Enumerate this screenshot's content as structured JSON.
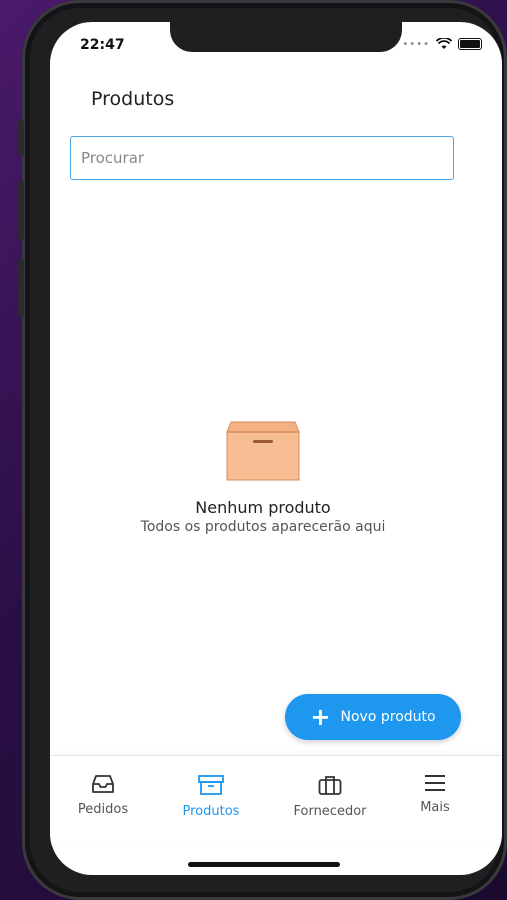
{
  "status": {
    "time": "22:47"
  },
  "header": {
    "title": "Produtos"
  },
  "search": {
    "placeholder": "Procurar"
  },
  "empty_state": {
    "title": "Nenhum produto",
    "subtitle": "Todos os produtos aparecerão aqui",
    "icon": "box-icon"
  },
  "fab": {
    "label": "Novo produto",
    "icon": "plus-icon"
  },
  "tabs": [
    {
      "label": "Pedidos",
      "icon": "inbox-icon"
    },
    {
      "label": "Produtos",
      "icon": "archive-icon",
      "active": true
    },
    {
      "label": "Fornecedor",
      "icon": "briefcase-icon"
    },
    {
      "label": "Mais",
      "icon": "menu-icon"
    }
  ],
  "colors": {
    "accent": "#1e97ee",
    "box": "#f7bd93"
  }
}
